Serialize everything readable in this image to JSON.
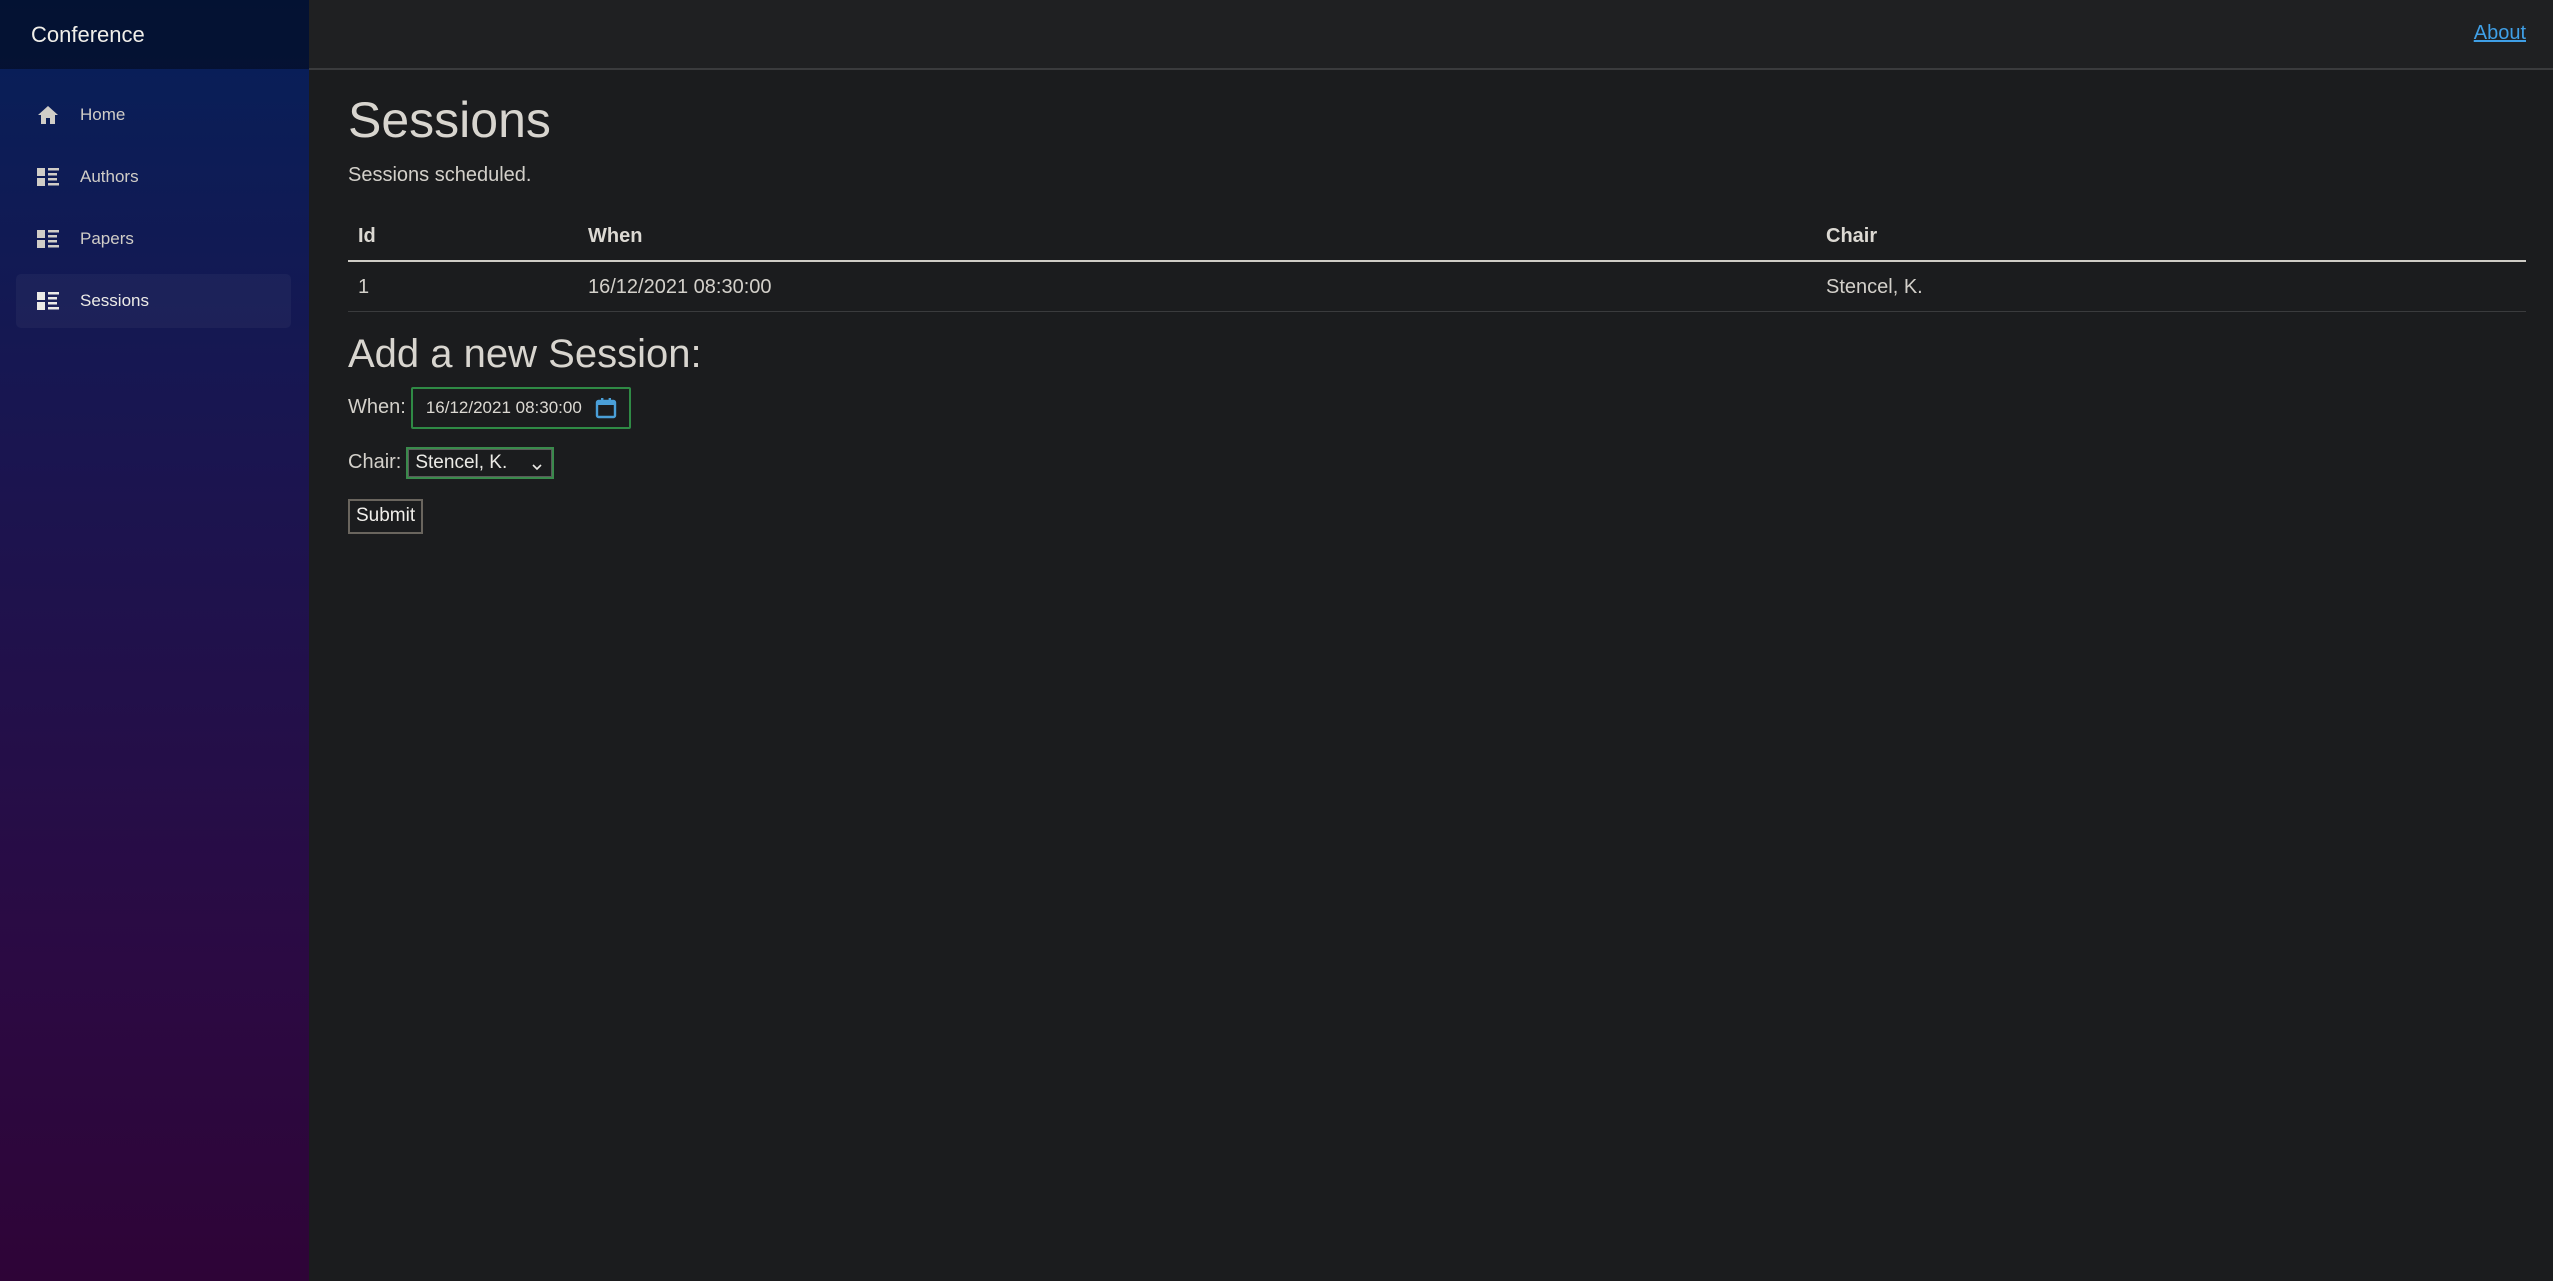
{
  "app": {
    "brand": "Conference"
  },
  "sidebar": {
    "items": [
      {
        "label": "Home",
        "icon": "home-icon",
        "active": false
      },
      {
        "label": "Authors",
        "icon": "list-icon",
        "active": false
      },
      {
        "label": "Papers",
        "icon": "list-icon",
        "active": false
      },
      {
        "label": "Sessions",
        "icon": "list-icon",
        "active": true
      }
    ]
  },
  "topbar": {
    "about_label": "About"
  },
  "page": {
    "title": "Sessions",
    "subtitle": "Sessions scheduled."
  },
  "table": {
    "headers": [
      "Id",
      "When",
      "Chair"
    ],
    "rows": [
      [
        "1",
        "16/12/2021 08:30:00",
        "Stencel, K."
      ]
    ]
  },
  "form": {
    "heading": "Add a new Session:",
    "when_label": "When:",
    "when_value": "16/12/2021 08:30:00",
    "chair_label": "Chair:",
    "chair_value": "Stencel, K.",
    "submit_label": "Submit"
  },
  "colors": {
    "accent_link": "#3f9fe6",
    "focus_border": "#2f8a45",
    "calendar_icon": "#4a9fd8"
  }
}
